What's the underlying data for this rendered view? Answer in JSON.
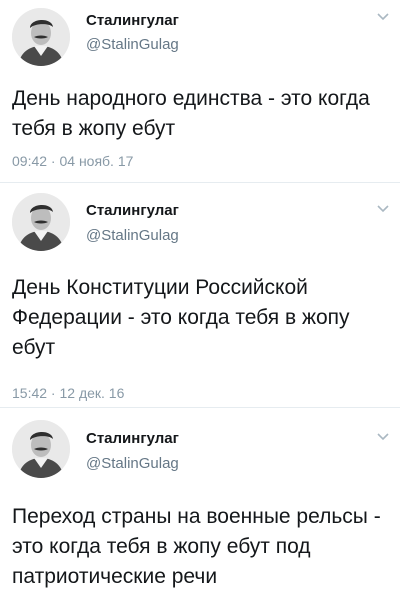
{
  "tweets": [
    {
      "author_name": "Сталингулаг",
      "author_handle": "@StalinGulag",
      "text": "День народного единства - это когда тебя в жопу ебут",
      "timestamp": "09:42 · 04 нояб. 17",
      "menu_icon": "chevron-down-icon"
    },
    {
      "author_name": "Сталингулаг",
      "author_handle": "@StalinGulag",
      "text": "День Конституции Российской Федерации - это когда тебя в жопу ебут",
      "timestamp": "15:42 · 12 дек. 16",
      "menu_icon": "chevron-down-icon"
    },
    {
      "author_name": "Сталингулаг",
      "author_handle": "@StalinGulag",
      "text": "Переход страны на военные рельсы - это когда тебя в жопу ебут под патриотические речи",
      "menu_icon": "chevron-down-icon"
    }
  ]
}
